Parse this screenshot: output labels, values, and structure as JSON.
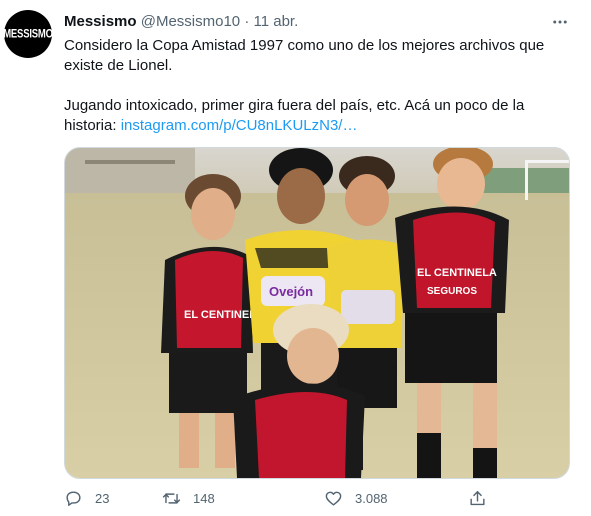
{
  "tweet": {
    "avatar_text": "MESSISMO",
    "author_name": "Messismo",
    "author_handle": "@Messismo10",
    "separator": "·",
    "date": "11 abr.",
    "text_line1": "Considero la Copa Amistad 1997 como uno de los mejores archivos que existe de Lionel.",
    "text_line2_prefix": "Jugando intoxicado, primer gira fuera del país, etc. Acá un poco de la historia: ",
    "text_link": "instagram.com/p/CU8nLKULzN3/…",
    "photo_shirt_text_1": "EL CENTINELA",
    "photo_shirt_text_2": "SEGUROS",
    "photo_sponsor_text": "Ovejón",
    "icons": {
      "more": "more-horizontal-icon",
      "reply": "reply-icon",
      "retweet": "retweet-icon",
      "like": "heart-icon",
      "share": "share-icon"
    }
  },
  "actions": {
    "reply_count": "23",
    "retweet_count": "148",
    "like_count": "3.088"
  },
  "colors": {
    "text": "#0f1419",
    "secondary": "#536471",
    "link": "#1d9bf0",
    "border": "#cfd9de"
  }
}
